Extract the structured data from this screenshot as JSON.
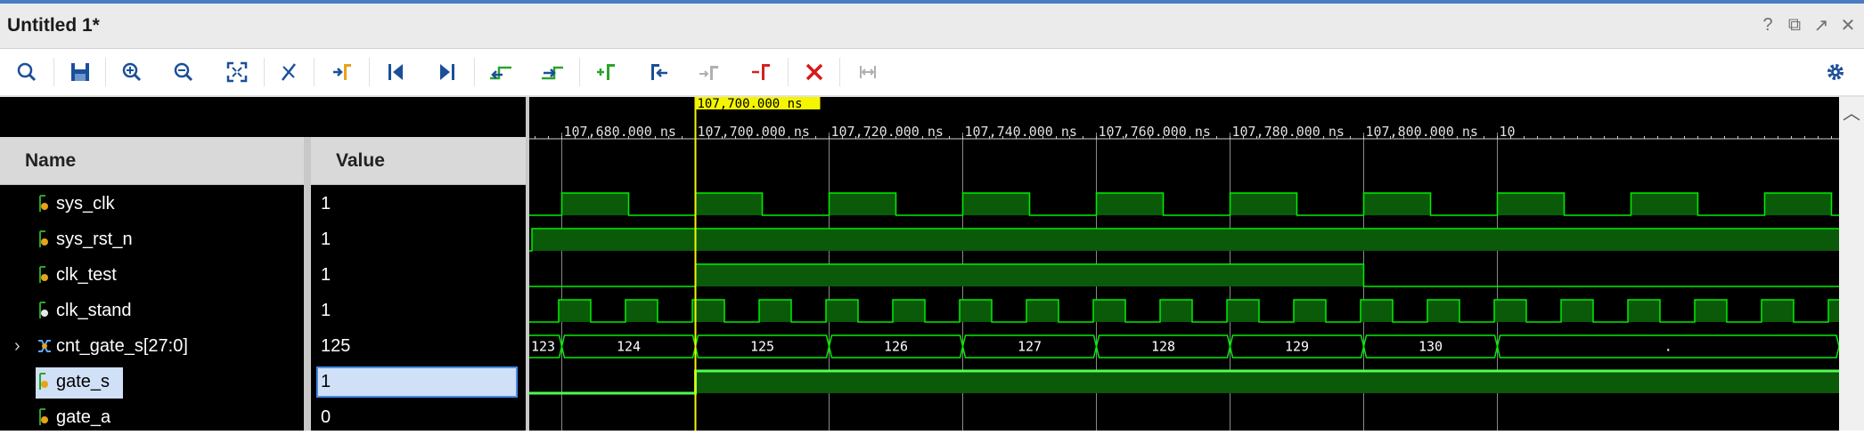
{
  "window": {
    "title": "Untitled 1*"
  },
  "window_buttons": [
    {
      "name": "help-icon",
      "glyph": "?"
    },
    {
      "name": "restore-icon",
      "glyph": "⧉"
    },
    {
      "name": "float-icon",
      "glyph": "↗"
    },
    {
      "name": "close-icon",
      "glyph": "✕"
    }
  ],
  "toolbar": {
    "buttons": [
      "search",
      "save",
      "zoom-in",
      "zoom-out",
      "zoom-fit",
      "cursor-to-zoom",
      "go-to-cursor",
      "go-to-time-0",
      "go-to-last-time",
      "previous-transition",
      "next-transition",
      "add-marker",
      "previous-marker",
      "next-marker",
      "swap-cursors",
      "delete-all-markers",
      "snap-to-transition",
      "settings"
    ]
  },
  "columns": {
    "name": "Name",
    "value": "Value"
  },
  "signals": [
    {
      "name": "sys_clk",
      "value": "1",
      "type": "bit"
    },
    {
      "name": "sys_rst_n",
      "value": "1",
      "type": "bit"
    },
    {
      "name": "clk_test",
      "value": "1",
      "type": "bit"
    },
    {
      "name": "clk_stand",
      "value": "1",
      "type": "bit"
    },
    {
      "name": "cnt_gate_s[27:0]",
      "value": "125",
      "type": "bus",
      "expandable": true
    },
    {
      "name": "gate_s",
      "value": "1",
      "type": "bit",
      "selected": true
    },
    {
      "name": "gate_a",
      "value": "0",
      "type": "bit"
    }
  ],
  "waveform": {
    "cursor_label": "107,700.000 ns",
    "time_labels": [
      "107,680.000 ns",
      "107,700.000 ns",
      "107,720.000 ns",
      "107,740.000 ns",
      "107,760.000 ns",
      "107,780.000 ns",
      "107,800.000 ns",
      "10"
    ],
    "bus_values": [
      "123",
      "124",
      "125",
      "126",
      "127",
      "128",
      "129",
      "130",
      "."
    ],
    "colors": {
      "wave": "#00ee00",
      "fill": "#0a5a0a",
      "cursor": "#f5f500",
      "grid": "#8a8a8a",
      "label_bg": "#f5f500"
    }
  }
}
